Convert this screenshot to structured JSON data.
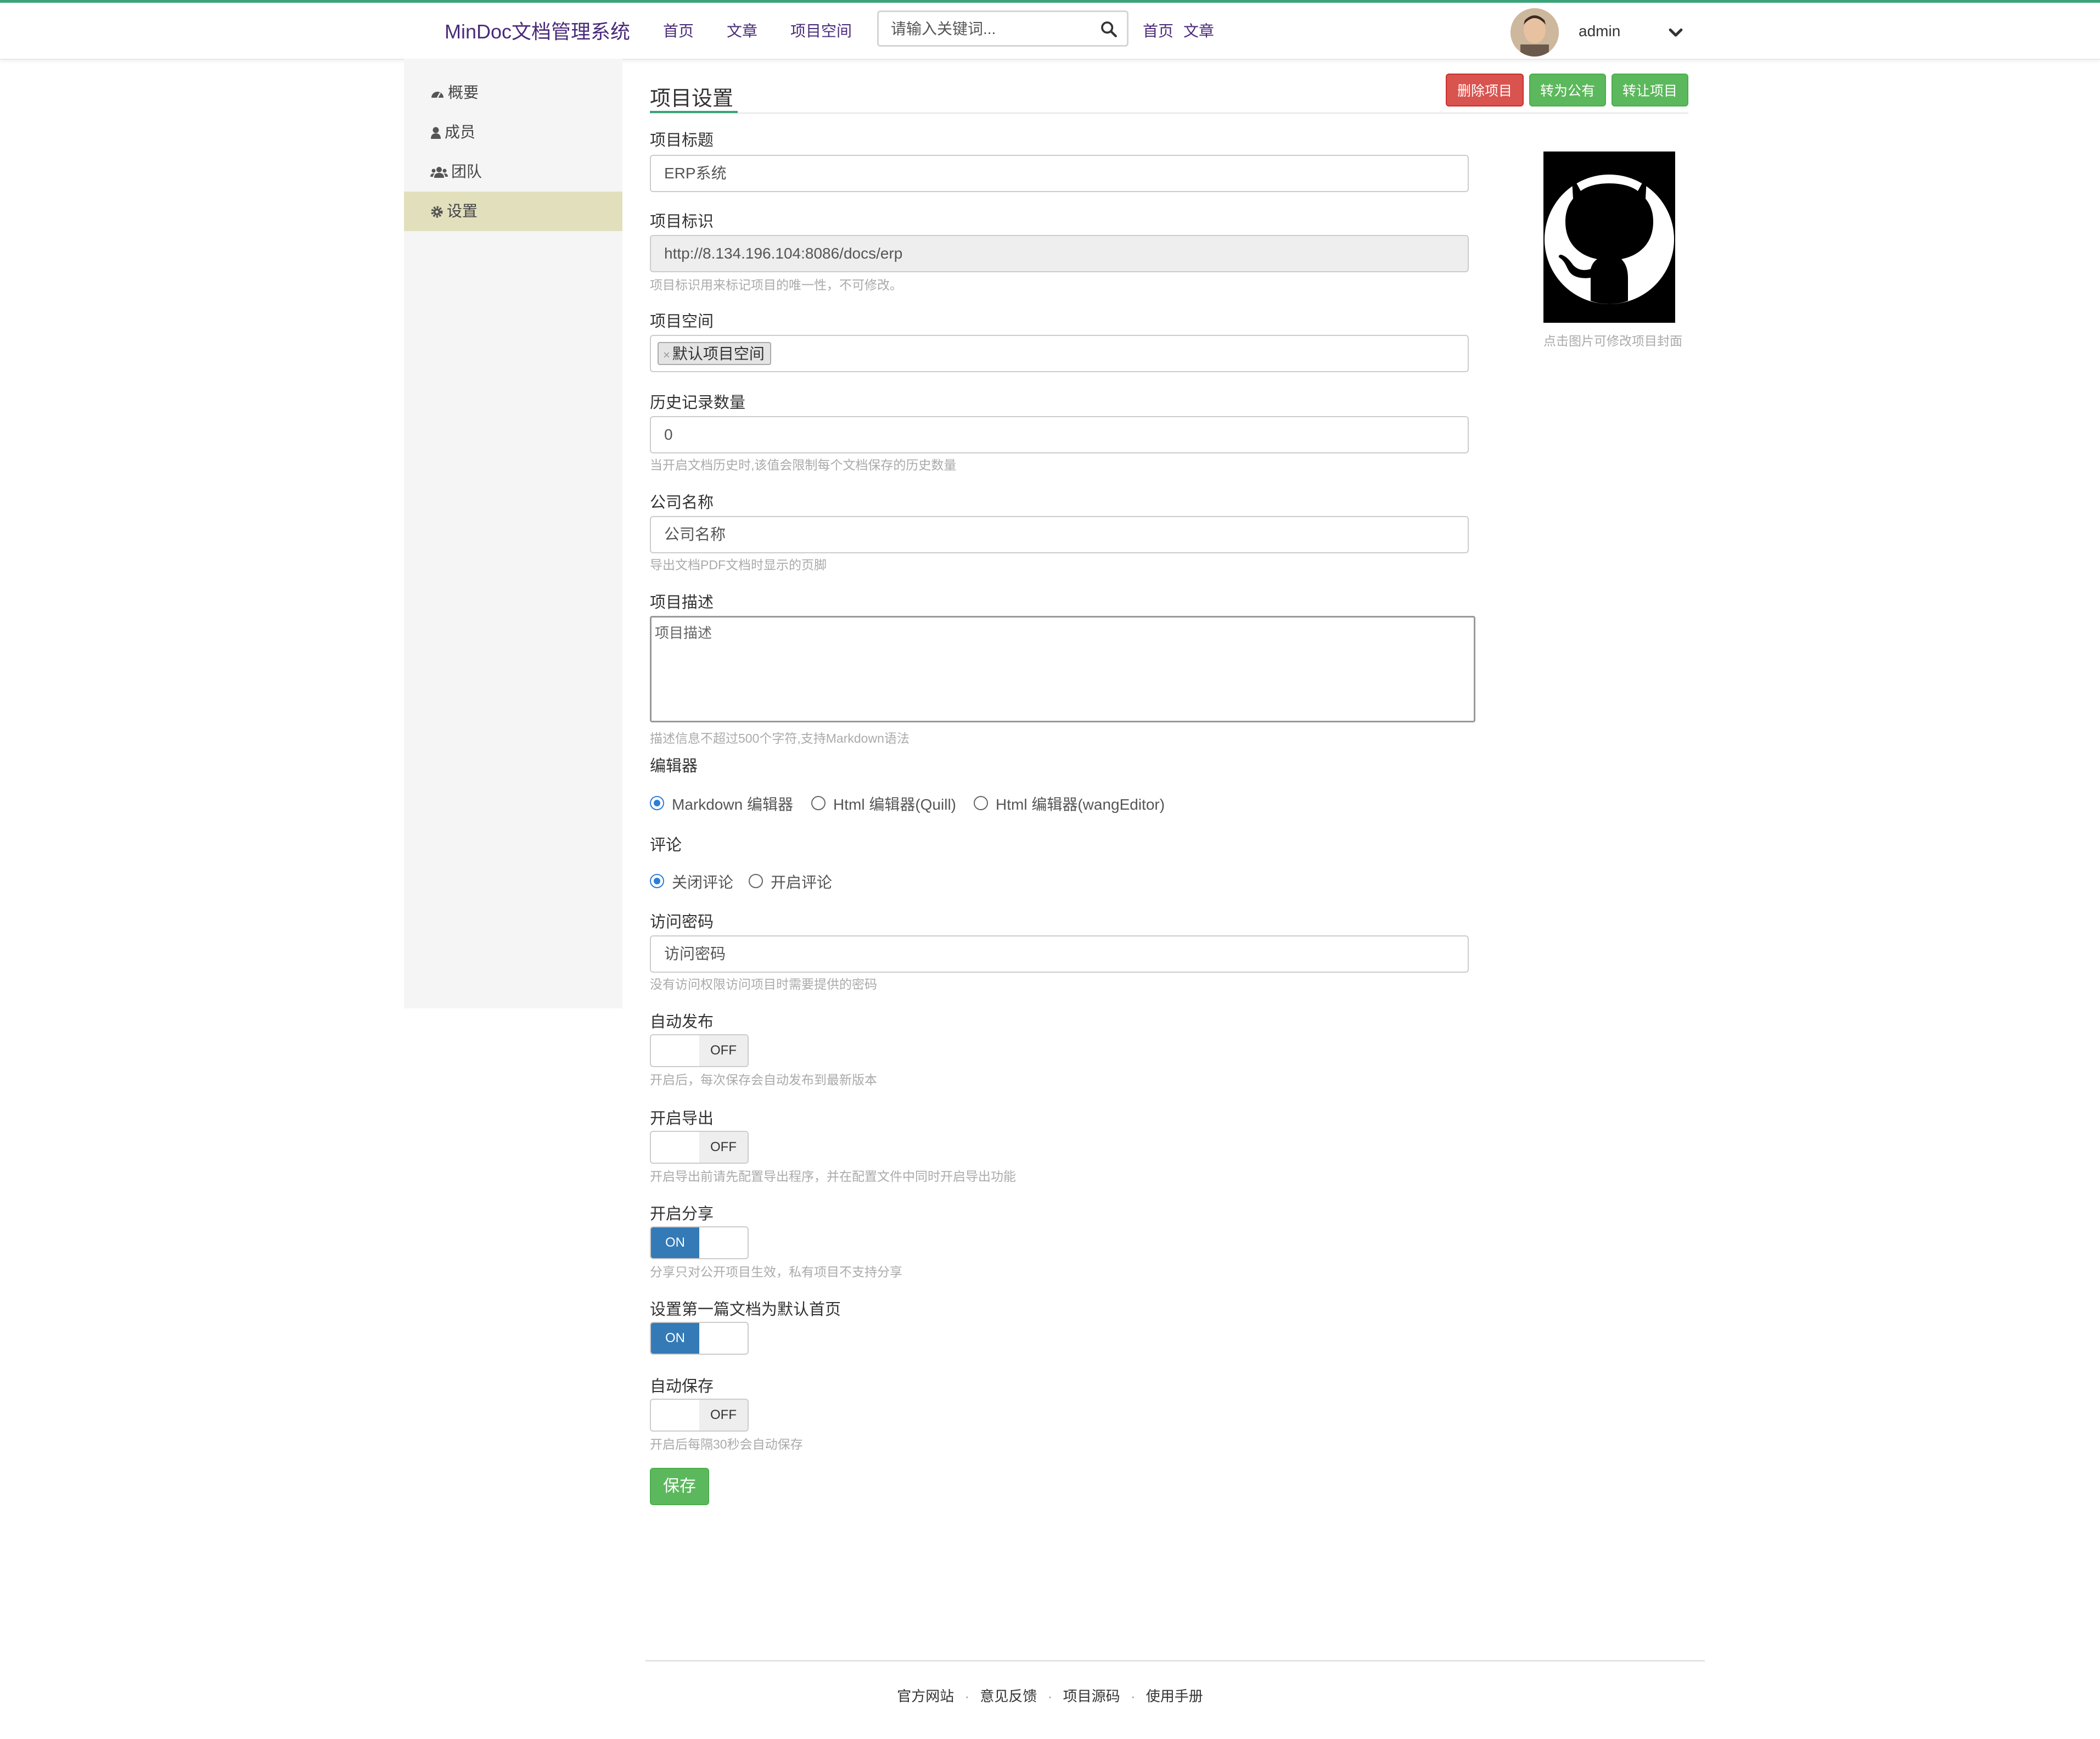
{
  "nav": {
    "brand": "MinDoc文档管理系统",
    "links": [
      "首页",
      "文章",
      "项目空间"
    ],
    "search_placeholder": "请输入关键词...",
    "links2": [
      "首页",
      "文章"
    ],
    "username": "admin"
  },
  "sidebar": {
    "items": [
      {
        "label": "概要",
        "icon": "dashboard-icon"
      },
      {
        "label": "成员",
        "icon": "user-icon"
      },
      {
        "label": "团队",
        "icon": "users-icon"
      },
      {
        "label": "设置",
        "icon": "gear-icon",
        "active": true
      }
    ]
  },
  "page": {
    "title": "项目设置",
    "actions": {
      "delete": "删除项目",
      "public": "转为公有",
      "transfer": "转让项目"
    }
  },
  "form": {
    "project_title": {
      "label": "项目标题",
      "value": "ERP系统"
    },
    "project_id": {
      "label": "项目标识",
      "value": "http://8.134.196.104:8086/docs/erp",
      "help": "项目标识用来标记项目的唯一性，不可修改。"
    },
    "space": {
      "label": "项目空间",
      "tag_remove": "×",
      "tag": "默认项目空间"
    },
    "history": {
      "label": "历史记录数量",
      "value": "0",
      "help": "当开启文档历史时,该值会限制每个文档保存的历史数量"
    },
    "company": {
      "label": "公司名称",
      "placeholder": "公司名称",
      "help": "导出文档PDF文档时显示的页脚"
    },
    "description": {
      "label": "项目描述",
      "placeholder": "项目描述",
      "help": "描述信息不超过500个字符,支持Markdown语法"
    },
    "editor": {
      "label": "编辑器",
      "options": [
        "Markdown 编辑器",
        "Html 编辑器(Quill)",
        "Html 编辑器(wangEditor)"
      ],
      "selected": "Markdown 编辑器"
    },
    "comment": {
      "label": "评论",
      "options": [
        "关闭评论",
        "开启评论"
      ],
      "selected": "关闭评论"
    },
    "password": {
      "label": "访问密码",
      "placeholder": "访问密码",
      "help": "没有访问权限访问项目时需要提供的密码"
    },
    "auto_release": {
      "label": "自动发布",
      "state": "OFF",
      "help": "开启后，每次保存会自动发布到最新版本"
    },
    "export": {
      "label": "开启导出",
      "state": "OFF",
      "help": "开启导出前请先配置导出程序，并在配置文件中同时开启导出功能"
    },
    "share": {
      "label": "开启分享",
      "state": "ON",
      "help": "分享只对公开项目生效，私有项目不支持分享"
    },
    "first_doc_home": {
      "label": "设置第一篇文档为默认首页",
      "state": "ON"
    },
    "auto_save": {
      "label": "自动保存",
      "state": "OFF",
      "help": "开启后每隔30秒会自动保存"
    },
    "save_label": "保存"
  },
  "cover": {
    "hint": "点击图片可修改项目封面",
    "icon": "github-octocat-icon"
  },
  "footer": {
    "links": [
      "官方网站",
      "意见反馈",
      "项目源码",
      "使用手册"
    ],
    "separator": "·"
  },
  "colors": {
    "accent": "#3aa37a",
    "brand": "#4a2b7a",
    "danger": "#d9534f",
    "success": "#5cb85c",
    "primary": "#337ab7",
    "sidebar_active": "#e2dfbd"
  }
}
